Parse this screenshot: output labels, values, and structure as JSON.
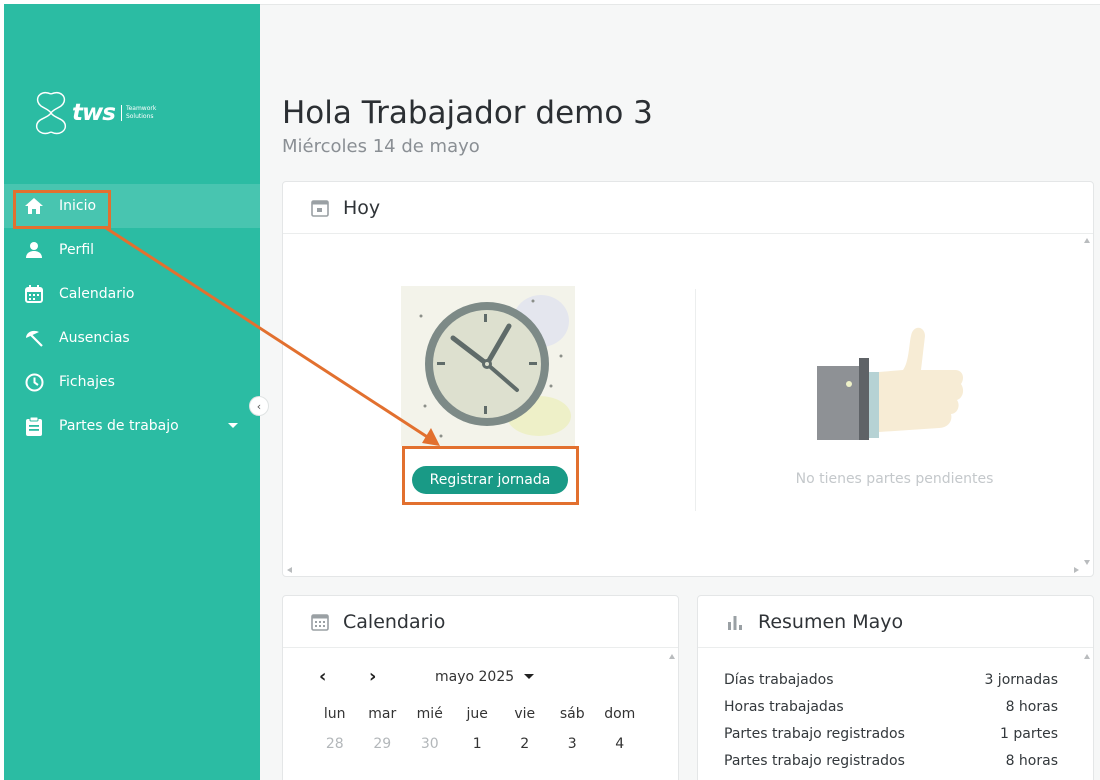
{
  "sidebar": {
    "logo": {
      "word": "tws",
      "sub_line1": "Teamwork",
      "sub_line2": "Solutions"
    },
    "items": [
      {
        "label": "Inicio",
        "icon": "home-icon"
      },
      {
        "label": "Perfil",
        "icon": "user-icon"
      },
      {
        "label": "Calendario",
        "icon": "calendar-icon"
      },
      {
        "label": "Ausencias",
        "icon": "beach-umbrella-icon"
      },
      {
        "label": "Fichajes",
        "icon": "clock-icon"
      },
      {
        "label": "Partes de trabajo",
        "icon": "clipboard-icon"
      }
    ],
    "active_item": "Inicio",
    "collapse_glyph": "‹"
  },
  "header": {
    "title": "Hola Trabajador demo 3",
    "date": "Miércoles 14 de mayo"
  },
  "today_card": {
    "title": "Hoy",
    "register_button": "Registrar jornada",
    "no_pending_text": "No tienes partes pendientes"
  },
  "calendar_card": {
    "title": "Calendario",
    "month_label": "mayo 2025",
    "prev_glyph": "‹",
    "next_glyph": "›",
    "weekdays": [
      "lun",
      "mar",
      "mié",
      "jue",
      "vie",
      "sáb",
      "dom"
    ],
    "days": [
      {
        "d": "28",
        "muted": true
      },
      {
        "d": "29",
        "muted": true
      },
      {
        "d": "30",
        "muted": true
      },
      {
        "d": "1",
        "muted": false
      },
      {
        "d": "2",
        "muted": false
      },
      {
        "d": "3",
        "muted": false
      },
      {
        "d": "4",
        "muted": false
      }
    ]
  },
  "summary_card": {
    "title": "Resumen Mayo",
    "rows": [
      {
        "label": "Días trabajados",
        "value": "3 jornadas"
      },
      {
        "label": "Horas trabajadas",
        "value": "8 horas"
      },
      {
        "label": "Partes trabajo registrados",
        "value": "1 partes"
      },
      {
        "label": "Partes trabajo registrados",
        "value": "8 horas"
      }
    ]
  },
  "colors": {
    "sidebar": "#2bbca3",
    "button": "#199a86",
    "highlight": "#e2702f"
  }
}
